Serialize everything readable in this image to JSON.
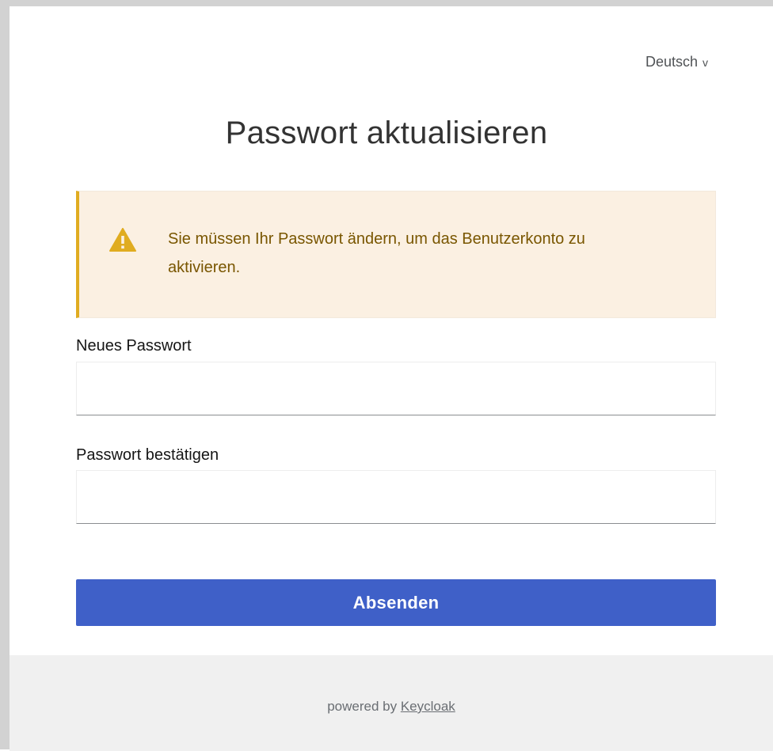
{
  "language": {
    "selected": "Deutsch",
    "chevron": "v"
  },
  "page": {
    "title": "Passwort aktualisieren"
  },
  "alert": {
    "icon": "warning-triangle-icon",
    "message": "Sie müssen Ihr Passwort ändern, um das Benutzerkonto zu aktivieren.",
    "color": "#e0ac20"
  },
  "form": {
    "new_password_label": "Neues Passwort",
    "new_password_value": "",
    "confirm_password_label": "Passwort bestätigen",
    "confirm_password_value": "",
    "submit_label": "Absenden"
  },
  "footer": {
    "powered_by": "powered by",
    "link_label": "Keycloak"
  },
  "colors": {
    "accent": "#3f60c8",
    "alert_background": "#fbf0e2",
    "footer_background": "#f0f0f0"
  }
}
